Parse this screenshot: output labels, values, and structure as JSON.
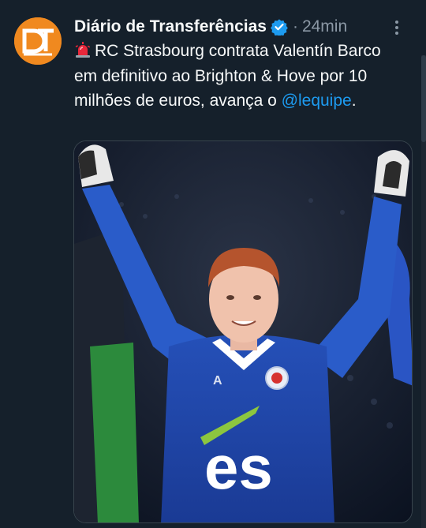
{
  "account": {
    "display_name": "Diário de Transferências",
    "avatar_monogram": "DT",
    "avatar_color": "#f0891f",
    "verified_icon": "verified-badge-icon",
    "separator": "·",
    "timestamp": "24min"
  },
  "tweet": {
    "siren_icon": "rotating-light-icon",
    "text_main": "RC Strasbourg contrata Valentín Barco em definitivo ao Brighton & Hove por 10 milhões de euros, avança o ",
    "mention": "@lequipe",
    "text_end": "."
  },
  "media": {
    "description_icon": "photo-player-celebrating",
    "shirt_sponsor": "es",
    "jersey_color": "#1f45a8"
  },
  "colors": {
    "background": "#15202b",
    "text_primary": "#f7f9f9",
    "text_secondary": "#8b98a5",
    "link": "#1d9bf0"
  }
}
